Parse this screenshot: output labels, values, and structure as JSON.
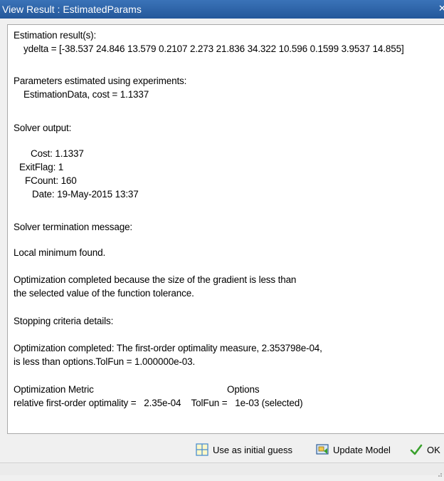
{
  "window": {
    "title": "View Result : EstimatedParams",
    "close_glyph": "✕"
  },
  "result": {
    "lines": [
      "Estimation result(s):",
      "ydelta = [-38.537 24.846 13.579 0.2107 2.273 21.836 34.322 10.596 0.1599 3.9537 14.855]",
      "Parameters estimated using experiments:",
      "EstimationData, cost = 1.1337",
      "Solver output:",
      "Cost: 1.1337",
      "ExitFlag: 1",
      "FCount: 160",
      "Date: 19-May-2015 13:37",
      "Solver termination message:",
      "Local minimum found.",
      "Optimization completed because the size of the gradient is less than",
      "the selected value of the function tolerance.",
      "Stopping criteria details:",
      "Optimization completed: The first-order optimality measure, 2.353798e-04,",
      "is less than options.TolFun = 1.000000e-03.",
      "Optimization Metric",
      "Options",
      "relative first-order optimality =   2.35e-04    TolFun =   1e-03 (selected)"
    ]
  },
  "footer": {
    "initial_guess_label": "Use as initial guess",
    "update_model_label": "Update Model",
    "ok_label": "OK"
  },
  "icons": {
    "initial_guess": "grid-icon",
    "update_model": "update-model-icon",
    "ok": "checkmark-icon"
  },
  "colors": {
    "title_bar": "#24579a",
    "accent_green": "#3aa12d"
  }
}
